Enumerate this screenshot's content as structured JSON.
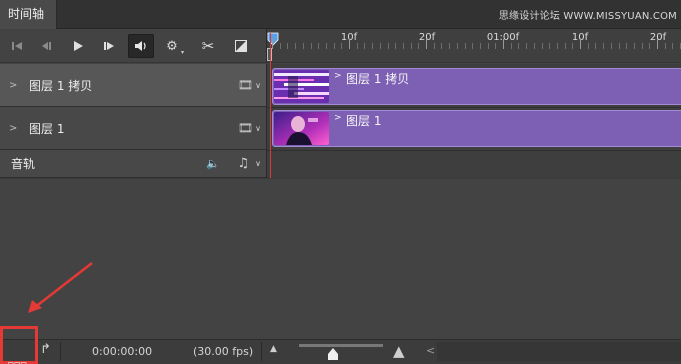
{
  "panel": {
    "tab_label": "时间轴"
  },
  "watermark": "思缘设计论坛 WWW.MISSYUAN.COM",
  "toolbar": {
    "buttons": [
      {
        "name": "go-to-first-frame",
        "glyph": "⏮"
      },
      {
        "name": "previous-frame",
        "glyph": "◂|"
      },
      {
        "name": "play",
        "glyph": "▶"
      },
      {
        "name": "next-frame",
        "glyph": "|▸"
      },
      {
        "name": "audio-toggle",
        "glyph": "🔊"
      },
      {
        "name": "settings",
        "glyph": "⚙"
      },
      {
        "name": "split-at-playhead",
        "glyph": "✂"
      },
      {
        "name": "transition",
        "glyph": "◪"
      }
    ]
  },
  "ruler": {
    "ticks": [
      "10f",
      "20f",
      "01:00f",
      "10f",
      "20f"
    ]
  },
  "layers": [
    {
      "label": "图层 1 拷贝",
      "clip_label": "图层 1 拷贝",
      "selected": true
    },
    {
      "label": "图层 1",
      "clip_label": "图层 1",
      "selected": false
    }
  ],
  "audio_track": {
    "label": "音轨"
  },
  "colors": {
    "clip_fill": "#7d5fb4",
    "playhead": "#d63a3a",
    "annotation": "#e53935",
    "playhead_marker": "#5aa0e8"
  },
  "status": {
    "timecode": "0:00:00:00",
    "fps": "(30.00 fps)"
  },
  "zoom_level": 0.4
}
